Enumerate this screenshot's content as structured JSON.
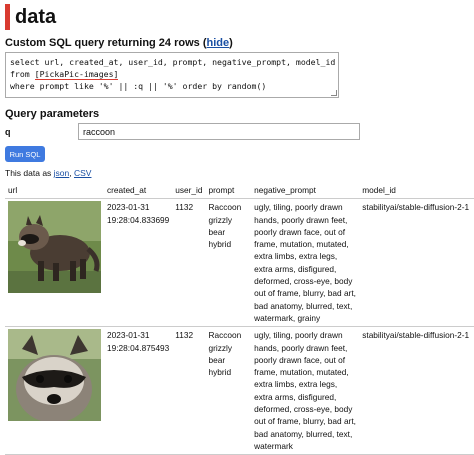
{
  "page": {
    "title": "data"
  },
  "sql": {
    "heading": "Custom SQL query returning 24 rows (",
    "hide_link": "hide",
    "heading_close": ")",
    "line1": "select url, created_at, user_id, prompt, negative_prompt, model_id",
    "line2_pre": "from ",
    "line2_table": "[PickaPic-images]",
    "line3": "where prompt like '%' || :q || '%' order by random()"
  },
  "params": {
    "heading": "Query parameters",
    "q_label": "q",
    "q_value": "raccoon"
  },
  "run_button": "Run SQL",
  "export": {
    "prefix": "This data as ",
    "json": "json",
    "sep": ", ",
    "csv": "CSV"
  },
  "table": {
    "columns": [
      "url",
      "created_at",
      "user_id",
      "prompt",
      "negative_prompt",
      "model_id"
    ],
    "rows": [
      {
        "image_icon": "raccoon-image",
        "created_at": "2023-01-31 19:28:04.833699",
        "user_id": "1132",
        "prompt": "Raccoon grizzly bear hybrid",
        "negative_prompt": "ugly, tiling, poorly drawn hands, poorly drawn feet, poorly drawn face, out of frame, mutation, mutated, extra limbs, extra legs, extra arms, disfigured, deformed, cross-eye, body out of frame, blurry, bad art, bad anatomy, blurred, text, watermark, grainy",
        "model_id": "stabilityai/stable-diffusion-2-1"
      },
      {
        "image_icon": "raccoon-face-image",
        "created_at": "2023-01-31 19:28:04.875493",
        "user_id": "1132",
        "prompt": "Raccoon grizzly bear hybrid",
        "negative_prompt": "ugly, tiling, poorly drawn hands, poorly drawn feet, poorly drawn face, out of frame, mutation, mutated, extra limbs, extra legs, extra arms, disfigured, deformed, cross-eye, body out of frame, blurry, bad art, bad anatomy, blurred, text, watermark",
        "model_id": "stabilityai/stable-diffusion-2-1"
      }
    ]
  },
  "colors": {
    "accent": "#d93b30",
    "link": "#1a4fa3",
    "button": "#3f7ae0"
  }
}
